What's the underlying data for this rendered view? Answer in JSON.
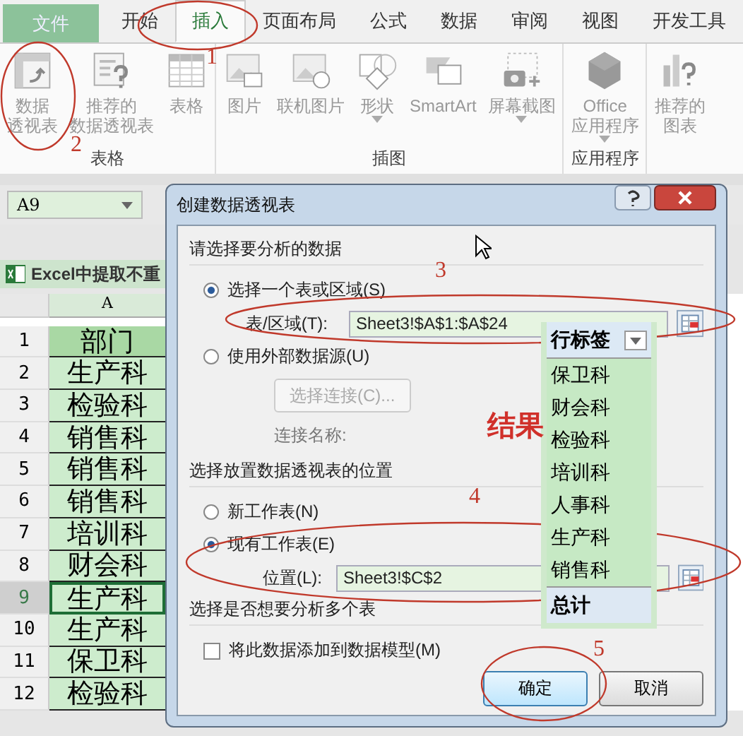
{
  "ribbon_tabs": [
    {
      "label": "文件",
      "kind": "file",
      "selected": false
    },
    {
      "label": "开始",
      "kind": "tab",
      "selected": false
    },
    {
      "label": "插入",
      "kind": "tab",
      "selected": true
    },
    {
      "label": "页面布局",
      "kind": "tab",
      "selected": false
    },
    {
      "label": "公式",
      "kind": "tab",
      "selected": false
    },
    {
      "label": "数据",
      "kind": "tab",
      "selected": false
    },
    {
      "label": "审阅",
      "kind": "tab",
      "selected": false
    },
    {
      "label": "视图",
      "kind": "tab",
      "selected": false
    },
    {
      "label": "开发工具",
      "kind": "tab",
      "selected": false
    }
  ],
  "ribbon_groups": [
    {
      "label": "表格",
      "buttons": [
        {
          "lines": [
            "数据",
            "透视表"
          ],
          "kind": "pivot",
          "dropdown": false
        },
        {
          "lines": [
            "推荐的",
            "数据透视表"
          ],
          "kind": "recommended-pivot",
          "dropdown": false
        },
        {
          "lines": [
            "表格"
          ],
          "kind": "table",
          "dropdown": false
        }
      ]
    },
    {
      "label": "插图",
      "buttons": [
        {
          "lines": [
            "图片"
          ],
          "kind": "picture",
          "dropdown": false
        },
        {
          "lines": [
            "联机图片"
          ],
          "kind": "online-picture",
          "dropdown": false
        },
        {
          "lines": [
            "形状"
          ],
          "kind": "shapes",
          "dropdown": true
        },
        {
          "lines": [
            "SmartArt"
          ],
          "kind": "smartart",
          "dropdown": false
        },
        {
          "lines": [
            "屏幕截图"
          ],
          "kind": "screenshot",
          "dropdown": true
        }
      ]
    },
    {
      "label": "应用程序",
      "buttons": [
        {
          "lines": [
            "Office",
            "应用程序"
          ],
          "kind": "office-apps",
          "dropdown": true
        }
      ]
    },
    {
      "buttons": [
        {
          "lines": [
            "推荐的",
            "图表"
          ],
          "kind": "recommended-chart",
          "dropdown": false
        }
      ]
    }
  ],
  "name_box": {
    "value": "A9"
  },
  "workbook_tab": {
    "title": "Excel中提取不重"
  },
  "sheet": {
    "column": "A",
    "rows": [
      {
        "number": "1",
        "value": "部门",
        "kind": "header",
        "selected": false
      },
      {
        "number": "2",
        "value": "生产科",
        "kind": "data",
        "selected": false
      },
      {
        "number": "3",
        "value": "检验科",
        "kind": "data",
        "selected": false
      },
      {
        "number": "4",
        "value": "销售科",
        "kind": "data",
        "selected": false
      },
      {
        "number": "5",
        "value": "销售科",
        "kind": "data",
        "selected": false
      },
      {
        "number": "6",
        "value": "销售科",
        "kind": "data",
        "selected": false
      },
      {
        "number": "7",
        "value": "培训科",
        "kind": "data",
        "selected": false
      },
      {
        "number": "8",
        "value": "财会科",
        "kind": "data",
        "selected": false
      },
      {
        "number": "9",
        "value": "生产科",
        "kind": "data",
        "selected": true
      },
      {
        "number": "10",
        "value": "生产科",
        "kind": "data",
        "selected": false
      },
      {
        "number": "11",
        "value": "保卫科",
        "kind": "data",
        "selected": false
      },
      {
        "number": "12",
        "value": "检验科",
        "kind": "data",
        "selected": false
      }
    ]
  },
  "dialog": {
    "title": "创建数据透视表",
    "source_heading": "请选择要分析的数据",
    "source_options": [
      {
        "label": "选择一个表或区域(S)",
        "selected": true
      },
      {
        "label": "使用外部数据源(U)",
        "selected": false
      }
    ],
    "range_field": {
      "label": "表/区域(T):",
      "value": "Sheet3!$A$1:$A$24"
    },
    "connection_button": {
      "label": "选择连接(C)...",
      "disabled": true
    },
    "connection_name_label": "连接名称:",
    "placement_heading": "选择放置数据透视表的位置",
    "placement_options": [
      {
        "label": "新工作表(N)",
        "selected": false
      },
      {
        "label": "现有工作表(E)",
        "selected": true
      }
    ],
    "location_field": {
      "label": "位置(L):",
      "value": "Sheet3!$C$2"
    },
    "multi_heading": "选择是否想要分析多个表",
    "data_model_checkbox": {
      "label": "将此数据添加到数据模型(M)",
      "checked": false
    },
    "buttons": [
      "确定",
      "取消"
    ]
  },
  "pivot_result": {
    "header": "行标签",
    "items": [
      "保卫科",
      "财会科",
      "检验科",
      "培训科",
      "人事科",
      "生产科",
      "销售科"
    ],
    "total": "总计"
  },
  "annotations": {
    "step_numbers": [
      "1",
      "2",
      "3",
      "4",
      "5"
    ],
    "result_label": "结果"
  }
}
